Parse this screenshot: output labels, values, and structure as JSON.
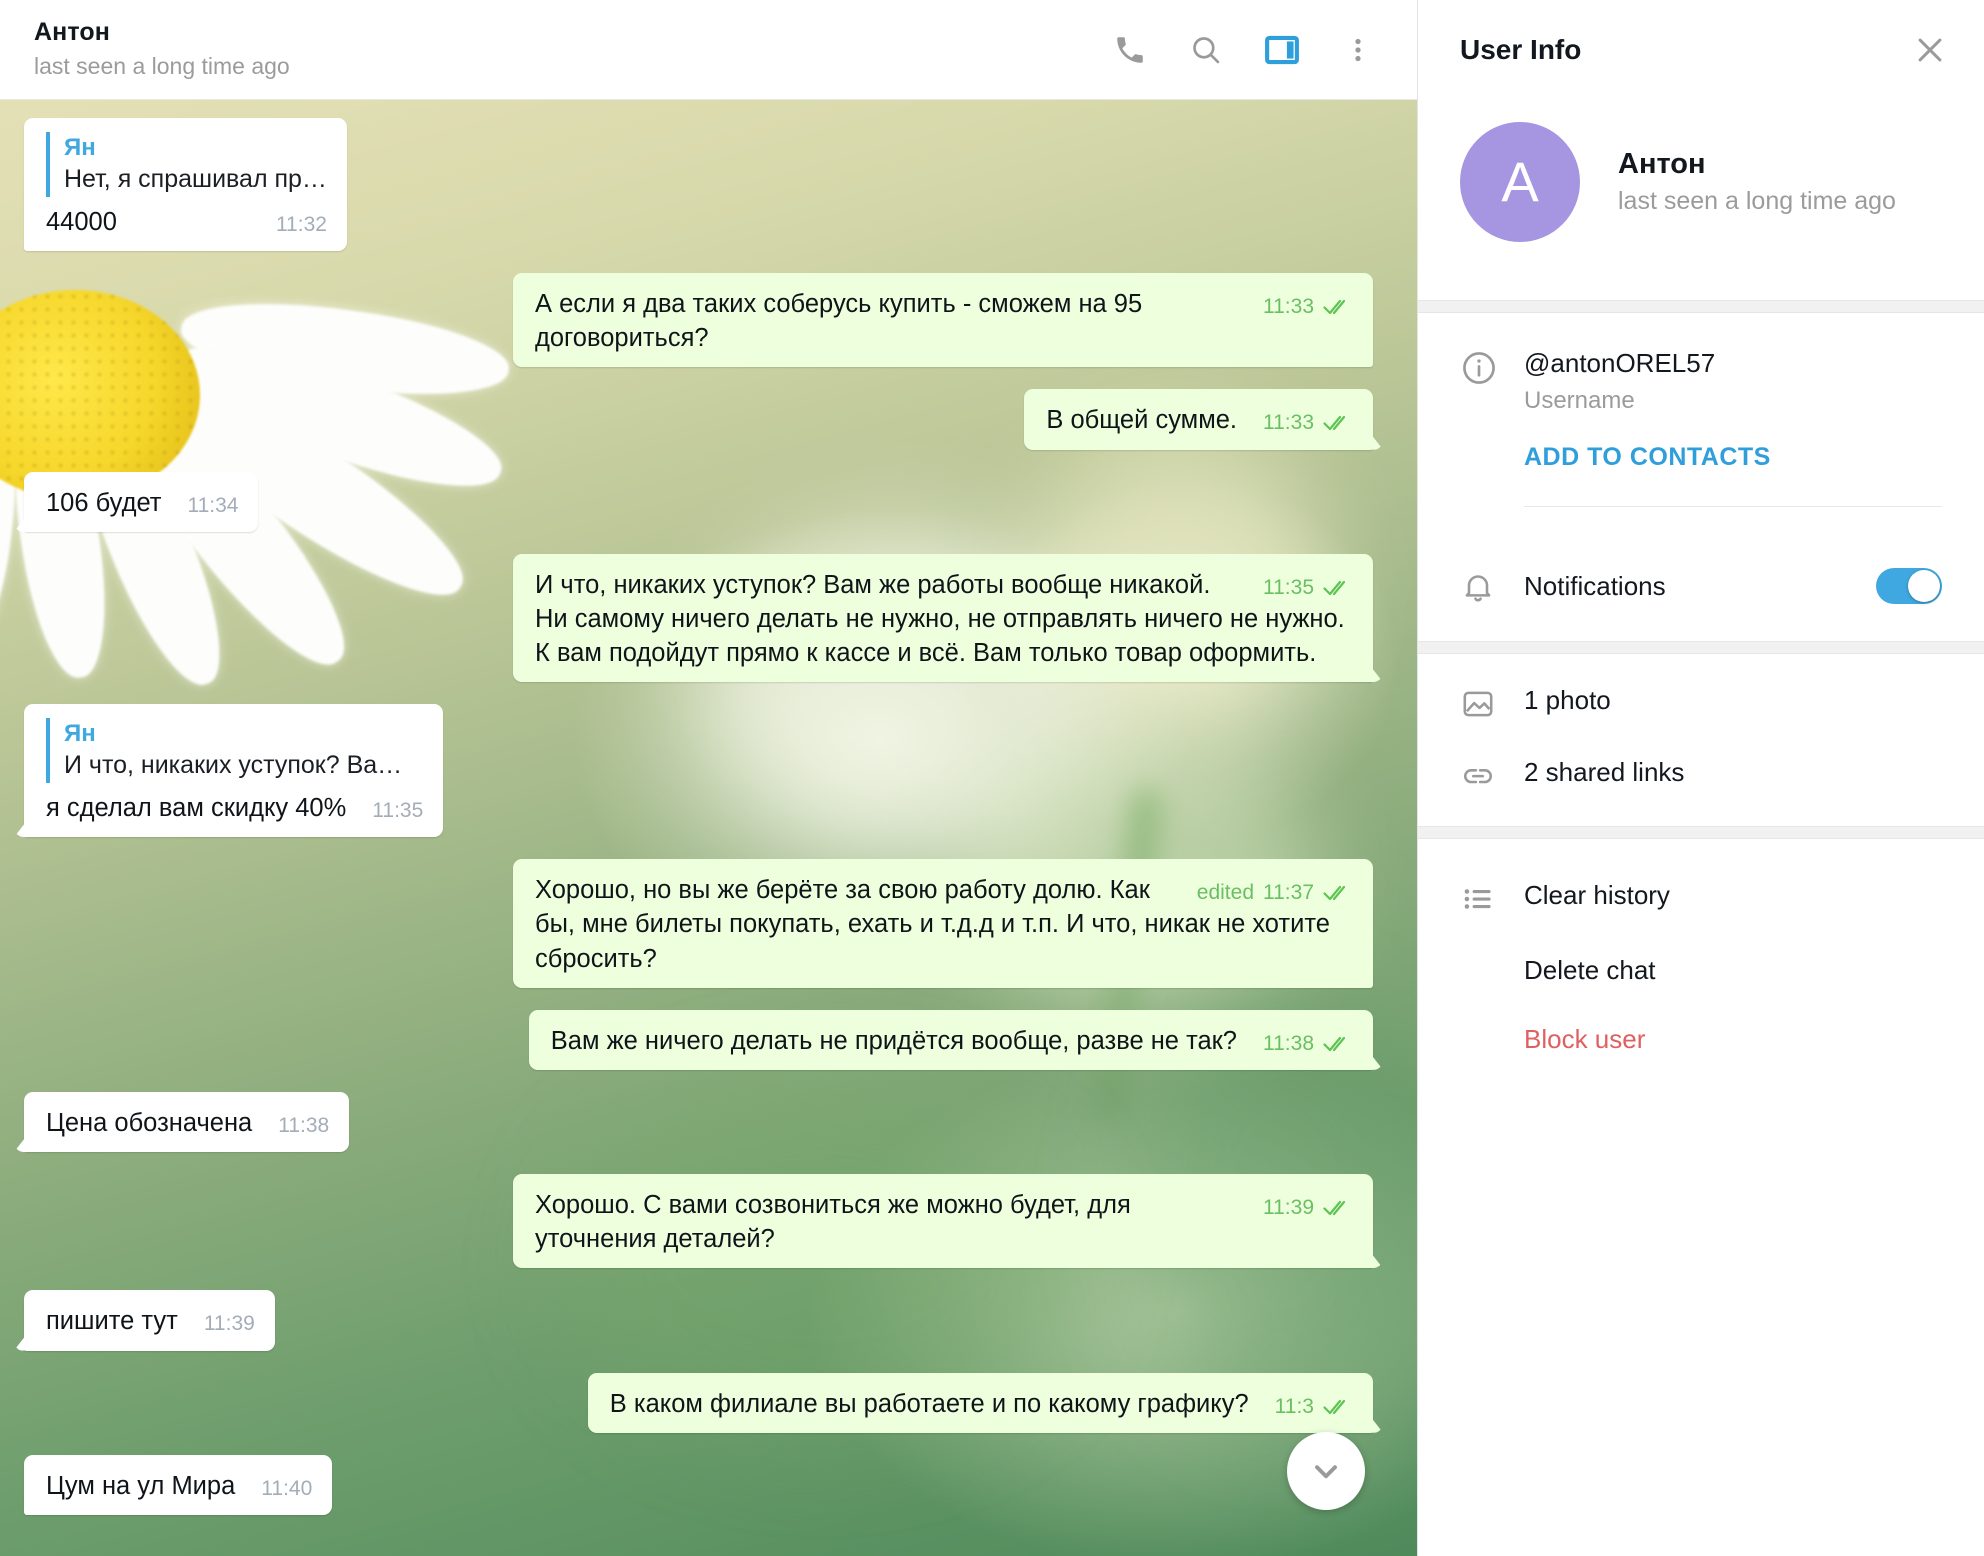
{
  "header": {
    "title": "Антон",
    "subtitle": "last seen a long time ago",
    "icons": {
      "call": "phone-icon",
      "search": "search-icon",
      "info": "info-panel-icon",
      "menu": "more-vertical-icon"
    }
  },
  "messages": [
    {
      "dir": "in",
      "tail": false,
      "reply": {
        "name": "Ян",
        "text": "Нет, я спрашивал пр…"
      },
      "text": "44000",
      "time": "11:32"
    },
    {
      "dir": "out",
      "tail": false,
      "text": "А если я два таких соберусь купить - сможем на 95 договориться?",
      "time": "11:33"
    },
    {
      "dir": "out",
      "tail": true,
      "text": "В общей сумме.",
      "time": "11:33"
    },
    {
      "dir": "in",
      "tail": true,
      "text": "106 будет",
      "time": "11:34"
    },
    {
      "dir": "out",
      "tail": true,
      "text": "И что, никаких уступок? Вам же работы вообще никакой. Ни самому ничего делать не нужно, не отправлять ничего не нужно. К вам подойдут прямо к кассе и всё. Вам только товар оформить.",
      "time": "11:35"
    },
    {
      "dir": "in",
      "tail": true,
      "reply": {
        "name": "Ян",
        "text": "И что, никаких уступок? Ва…"
      },
      "text": "я сделал вам скидку 40%",
      "time": "11:35"
    },
    {
      "dir": "out",
      "tail": false,
      "text": "Хорошо, но вы же берёте за свою работу долю. Как бы, мне билеты покупать, ехать и т.д.д и т.п. И что, никак не хотите сбросить?",
      "edited": "edited",
      "time": "11:37"
    },
    {
      "dir": "out",
      "tail": true,
      "text": "Вам же ничего делать не придётся вообще, разве не так?",
      "time": "11:38"
    },
    {
      "dir": "in",
      "tail": true,
      "text": "Цена обозначена",
      "time": "11:38"
    },
    {
      "dir": "out",
      "tail": true,
      "text": "Хорошо. С вами созвониться же можно будет, для уточнения деталей?",
      "time": "11:39"
    },
    {
      "dir": "in",
      "tail": true,
      "text": "пишите тут",
      "time": "11:39"
    },
    {
      "dir": "out",
      "tail": true,
      "text": "В каком филиале вы работаете и по какому графику?",
      "time": "11:3"
    },
    {
      "dir": "in",
      "tail": false,
      "text": "Цум на ул Мира",
      "time": "11:40"
    }
  ],
  "scroll_down_button": "scroll-to-bottom",
  "info_panel": {
    "title": "User Info",
    "close": "close-icon",
    "avatar_letter": "A",
    "name": "Антон",
    "status": "last seen a long time ago",
    "username": {
      "value": "@antonOREL57",
      "label": "Username",
      "icon": "info-circle-icon"
    },
    "add_to_contacts": "ADD TO CONTACTS",
    "notifications": {
      "label": "Notifications",
      "icon": "bell-icon",
      "enabled": true
    },
    "media": [
      {
        "icon": "photo-icon",
        "label": "1 photo"
      },
      {
        "icon": "link-icon",
        "label": "2 shared links"
      }
    ],
    "actions": [
      {
        "icon": "list-icon",
        "label": "Clear history",
        "danger": false
      },
      {
        "icon": "",
        "label": "Delete chat",
        "danger": false
      },
      {
        "icon": "",
        "label": "Block user",
        "danger": true
      }
    ]
  },
  "colors": {
    "accent": "#3fa8e0",
    "outgoing_bubble": "#eeffde",
    "incoming_bubble": "#ffffff",
    "danger": "#e06060",
    "avatar": "#a695e0",
    "tick_green": "#5dc452"
  }
}
